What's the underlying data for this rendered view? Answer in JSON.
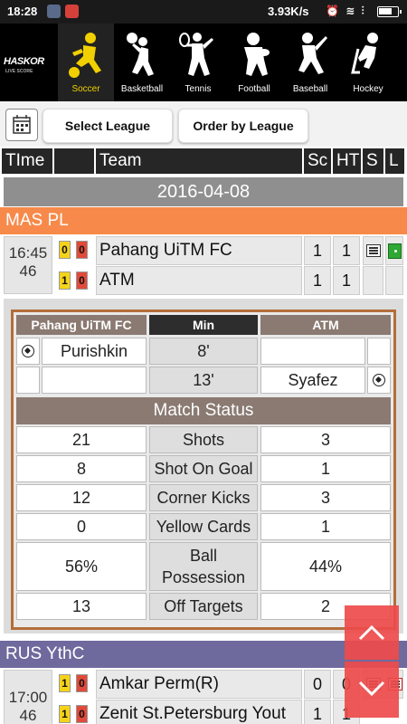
{
  "status_bar": {
    "time": "18:28",
    "speed": "3.93K/s",
    "icons": "⏰ ≋ ⫶",
    "colors": {
      "bg": "#1a1a1a"
    }
  },
  "logo": {
    "text": "HASKOR",
    "sub": "LIVE SCORE"
  },
  "sports": [
    {
      "label": "Soccer",
      "icon": "soccer-player-icon",
      "active": true
    },
    {
      "label": "Basketball",
      "icon": "basketball-player-icon",
      "active": false
    },
    {
      "label": "Tennis",
      "icon": "tennis-player-icon",
      "active": false
    },
    {
      "label": "Football",
      "icon": "football-player-icon",
      "active": false
    },
    {
      "label": "Baseball",
      "icon": "baseball-player-icon",
      "active": false
    },
    {
      "label": "Hockey",
      "icon": "hockey-player-icon",
      "active": false
    }
  ],
  "filters": {
    "select_league": "Select League",
    "order_by_league": "Order by League"
  },
  "columns": {
    "time": "TIme",
    "team": "Team",
    "sc": "Sc",
    "ht": "HT",
    "s": "S",
    "l": "L"
  },
  "date": "2016-04-08",
  "leagues": [
    {
      "name": "MAS PL",
      "color": "#f78a4a",
      "match": {
        "time": "16:45",
        "minute": "46",
        "home": {
          "name": "Pahang UiTM FC",
          "yellow": "0",
          "red": "0",
          "score": "1",
          "ht": "1"
        },
        "away": {
          "name": "ATM",
          "yellow": "1",
          "red": "0",
          "score": "1",
          "ht": "1"
        }
      }
    },
    {
      "name": "RUS YthC",
      "color": "#6e6a9e",
      "match": {
        "time": "17:00",
        "minute": "46",
        "home": {
          "name": "Amkar Perm(R)",
          "yellow": "1",
          "red": "0",
          "score": "0",
          "ht": "0"
        },
        "away": {
          "name": "Zenit St.Petersburg Yout",
          "yellow": "1",
          "red": "0",
          "score": "1",
          "ht": "1"
        }
      }
    }
  ],
  "detail": {
    "home_team": "Pahang UiTM FC",
    "min_label": "Min",
    "away_team": "ATM",
    "events": [
      {
        "home_player": "Purishkin",
        "minute": "8'",
        "away_player": ""
      },
      {
        "home_player": "",
        "minute": "13'",
        "away_player": "Syafez"
      }
    ],
    "status_title": "Match Status",
    "stats": [
      {
        "home": "21",
        "label": "Shots",
        "away": "3"
      },
      {
        "home": "8",
        "label": "Shot On Goal",
        "away": "1"
      },
      {
        "home": "12",
        "label": "Corner Kicks",
        "away": "3"
      },
      {
        "home": "0",
        "label": "Yellow Cards",
        "away": "1"
      },
      {
        "home": "56%",
        "label": "Ball Possession",
        "away": "44%"
      },
      {
        "home": "13",
        "label": "Off Targets",
        "away": "2"
      }
    ],
    "colors": {
      "border": "#b36e3b",
      "header_dark": "#2d2d2d",
      "header_grey": "#8a7a72"
    }
  }
}
